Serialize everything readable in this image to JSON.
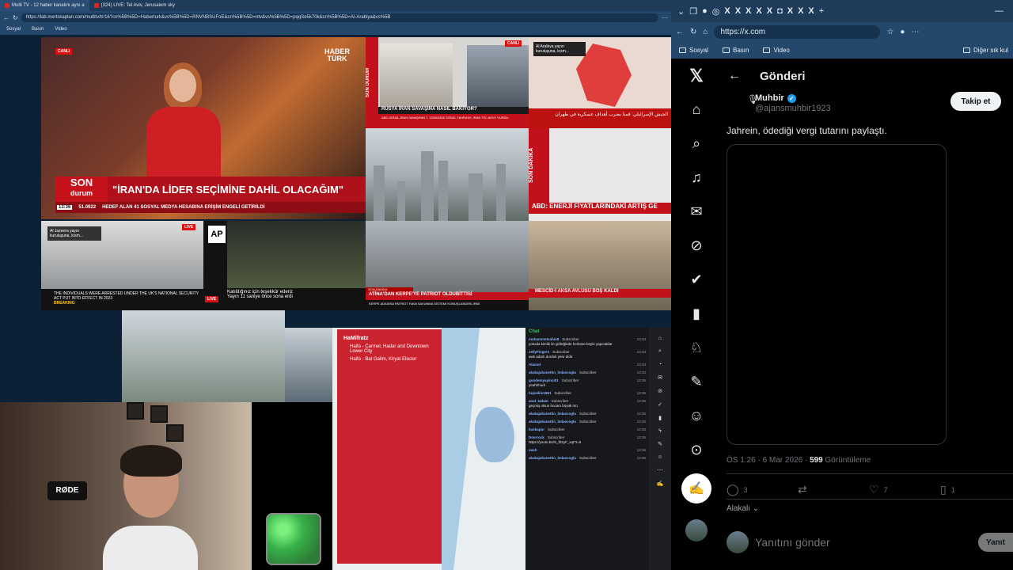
{
  "left_browser": {
    "tabs": [
      {
        "label": "Multi TV - 12 haber kanalını aynı a"
      },
      {
        "label": "(324) LIVE: Tel Aviv, Jerusalem sky"
      }
    ],
    "url": "https://lab.mertskaplan.com/multitv/tr/16?cn%5B%5D=Haberturk&vs%5B%5D=RNVNBSUFoE&cn%5B%5D=ntv&vs%5B%5D=pqqSe5k70k&cn%5B%5D=Al-Arabiya&vs%5B",
    "bookmarks": [
      "Sosyal",
      "Basın",
      "Video"
    ]
  },
  "tiles": {
    "main": {
      "live_chip": "CANLI",
      "brand_line1": "HABER",
      "brand_line2": "TÜRK",
      "son_line1": "SON",
      "son_line2": "durum",
      "headline": "\"İRAN'DA LİDER SEÇİMİNE DAHİL OLACAĞIM\"",
      "ticker_time": "13:36",
      "ticker_index": "51.0922",
      "ticker_text": "HEDEF ALAN 41 SOSYAL MEDYA HESABINA ERİŞİM ENGELİ GETİRİLDİ"
    },
    "ntv": {
      "side_label": "SON DURUM",
      "live_chip": "CANLI",
      "bar_title": "RUSYA İRAN SAVAŞINA NASIL BAKIYOR?",
      "bar_sub": "ABD-İSRAİL-İRAN SAVAŞININ 7. GÜNÜNDE İSRAİL TAHRAN'I, İRAN TEL AVİV'İ VURDU"
    },
    "arabiya": {
      "chip_text": "Al Arabiya yayın kuruluşuna, kısm...",
      "bar_text": "الجيش الإسرائيلي: قمنا بضرب أهداف عسكرية في طهران"
    },
    "cnn": {
      "side_label": "SON DAKİKA",
      "bar_text": "ABD: ENERJİ FİYATLARINDAKİ ARTIŞ GE"
    },
    "aljazeera": {
      "chip_text": "Al Jazeera yayın kuruluşuna, kısm...",
      "live_chip": "LIVE",
      "bar_text": "THE INDIVIDUALS WERE ARRESTED UNDER THE UK'S NATIONAL SECURITY ACT PUT INTO EFFECT IN 2023",
      "breaking": "BREAKING"
    },
    "ap": {
      "logo": "AP",
      "note_line1": "Katıldığınız için teşekkür ederiz",
      "note_line2": "Yayın 11 saniye önce sona erdi",
      "live_label": "LIVE"
    },
    "athens": {
      "pre_label": "SON DAKİKA",
      "bar_text": "ATİNA'DAN KERPE'YE PATRIOT OLDUBİTTİSİ",
      "sub": "KERPE ADASINA PATRIOT HAVA SAVUNMA SİSTEMİ KONUŞLANDIRILIRMI"
    },
    "trt": {
      "bar_text": "MESCİD-İ AKSA AVLUSU BOŞ KALDI"
    }
  },
  "map_panel": {
    "title": "HaMifratz",
    "line1": "Haifa - Carmel, Hadar and Downtown Lower City",
    "line2": "Haifa - Bat Galim, Kiryat Eliezer"
  },
  "chat": {
    "header": "Chat",
    "messages": [
      {
        "user": "muhammetsahin8",
        "badge": "Subscriber",
        "text": "yokoda kimlik ile girileğinde herkese böyle yapıcaklar",
        "time": "13:34"
      },
      {
        "user": "JellyFingers",
        "badge": "Subscriber",
        "text": "awk adam durduk yere didü",
        "time": "13:34"
      },
      {
        "user": "Alaxod",
        "badge": "",
        "text": "",
        "time": "13:34"
      },
      {
        "user": "akakajuhanettin_lmlaecoglu",
        "badge": "Subscriber",
        "text": "",
        "time": "13:34"
      },
      {
        "user": "gundemyayinci01",
        "badge": "Subscriber",
        "text": "yeahhhudi",
        "time": "13:35"
      },
      {
        "user": "hujoekin1961",
        "badge": "Subscriber",
        "text": "",
        "time": "13:35"
      },
      {
        "user": "anal_tadam",
        "badge": "Subscriber",
        "text": "geçmiş olsun hocam büyük mü",
        "time": "13:35"
      },
      {
        "user": "akakajuhanettin_lmlaecoglu",
        "badge": "Subscriber",
        "text": "",
        "time": "13:35"
      },
      {
        "user": "akakajuhanettin_lmlaecoglu",
        "badge": "Subscriber",
        "text": "",
        "time": "13:35"
      },
      {
        "user": "kuskapor",
        "badge": "Subscriber",
        "text": "",
        "time": "13:35"
      },
      {
        "user": "Doerrock",
        "badge": "Subscriber",
        "text": "https://youtu.be/S_f02yF_xqI?t=6",
        "time": "13:35"
      },
      {
        "user": "nash",
        "badge": "",
        "text": "",
        "time": "13:36"
      },
      {
        "user": "akakajuhanettin_lmlaecoglu",
        "badge": "Subscriber",
        "text": "",
        "time": "13:36"
      }
    ]
  },
  "webcam": {
    "mic_label": "RØDE"
  },
  "right_browser": {
    "url": "https://x.com",
    "bookmarks": [
      "Sosyal",
      "Basın",
      "Video",
      "Diğer sık kul"
    ]
  },
  "x": {
    "page_title": "Gönderi",
    "author_name": "Muhbir",
    "author_handle": "@ajansmuhbir1923",
    "follow_label": "Takip et",
    "tweet_text": "Jahrein, ödediği vergi tutarını paylaştı.",
    "timestamp": "ÖS 1:26 · 6 Mar 2026 · ",
    "views": "599",
    "views_label": " Görüntüleme",
    "replies": "3",
    "reposts": "",
    "likes": "7",
    "bookmarks": "1",
    "sort_label": "Alakalı",
    "reply_placeholder": "Yanıtını gönder",
    "reply_button": "Yanıt"
  },
  "colors": {
    "x_background": "#000000",
    "x_text": "#e7e9ea",
    "x_secondary": "#71767b",
    "verified_blue": "#1d9bf0",
    "news_red": "#c2111b"
  }
}
